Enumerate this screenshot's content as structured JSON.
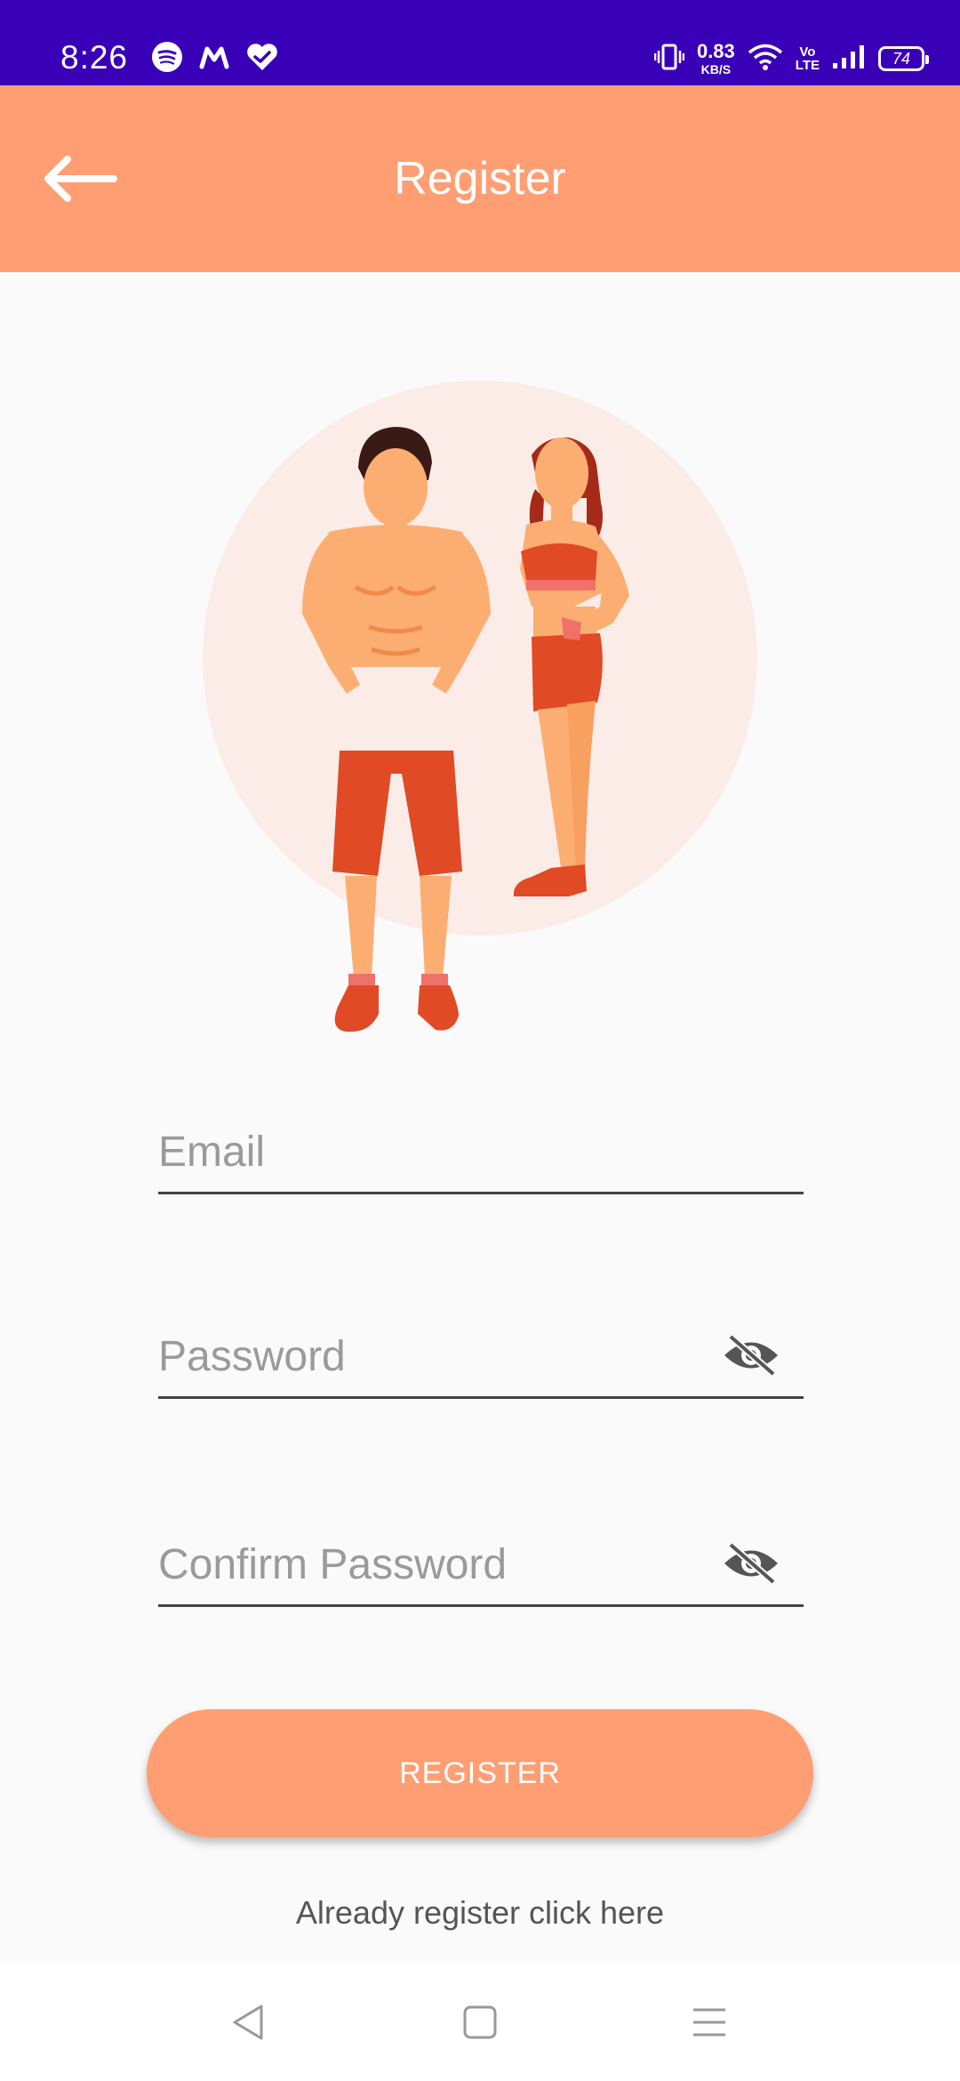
{
  "status_bar": {
    "time": "8:26",
    "net_speed_value": "0.83",
    "net_speed_unit": "KB/S",
    "volte_top": "Vo",
    "volte_bottom": "LTE",
    "battery": "74",
    "left_icons": [
      "spotify-icon",
      "m-app-icon",
      "heart-check-icon"
    ],
    "right_icons": [
      "vibrate-icon",
      "wifi-icon",
      "signal-icon"
    ]
  },
  "app_bar": {
    "title": "Register",
    "back_icon": "arrow-left-icon"
  },
  "form": {
    "email_placeholder": "Email",
    "password_placeholder": "Password",
    "confirm_password_placeholder": "Confirm Password",
    "visibility_icon": "eye-off-icon",
    "register_label": "REGISTER",
    "login_link": "Already register click here"
  },
  "colors": {
    "status_bar": "#3a00b8",
    "accent": "#ff9e73",
    "illustration_bg": "#fbece7",
    "illustration_red": "#e04a25",
    "skin": "#fcae72"
  },
  "nav_bar": {
    "icons": [
      "back-triangle-icon",
      "home-square-icon",
      "menu-lines-icon"
    ]
  }
}
